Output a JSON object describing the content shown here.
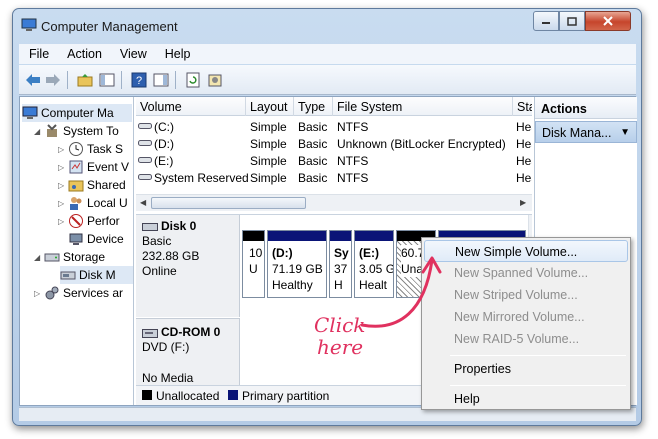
{
  "window": {
    "title": "Computer Management"
  },
  "menu": [
    "File",
    "Action",
    "View",
    "Help"
  ],
  "tree": {
    "root": "Computer Ma",
    "system_tools": "System To",
    "task_scheduler": "Task S",
    "event_viewer": "Event V",
    "shared_folders": "Shared",
    "local_users": "Local U",
    "performance": "Perfor",
    "device_manager": "Device",
    "storage": "Storage",
    "disk_management": "Disk M",
    "services": "Services ar"
  },
  "volume_list": {
    "headers": [
      "Volume",
      "Layout",
      "Type",
      "File System",
      "Stat"
    ],
    "rows": [
      {
        "volume": "(C:)",
        "layout": "Simple",
        "type": "Basic",
        "fs": "NTFS",
        "status": "Hea"
      },
      {
        "volume": "(D:)",
        "layout": "Simple",
        "type": "Basic",
        "fs": "Unknown (BitLocker Encrypted)",
        "status": "Hea"
      },
      {
        "volume": "(E:)",
        "layout": "Simple",
        "type": "Basic",
        "fs": "NTFS",
        "status": "Hea"
      },
      {
        "volume": "System Reserved",
        "layout": "Simple",
        "type": "Basic",
        "fs": "NTFS",
        "status": "Hea"
      }
    ]
  },
  "disk0": {
    "name": "Disk 0",
    "type": "Basic",
    "size": "232.88 GB",
    "status": "Online",
    "partitions": [
      {
        "line1": "10",
        "line2": "U"
      },
      {
        "line1": "(D:)",
        "line2": "71.19 GB",
        "line3": "Healthy"
      },
      {
        "line1": "Sy",
        "line2": "37",
        "line3": "H"
      },
      {
        "line1": "(E:)",
        "line2": "3.05 G",
        "line3": "Healt"
      },
      {
        "line1": "60.79",
        "line2": "Unall"
      }
    ]
  },
  "cdrom": {
    "name": "CD-ROM 0",
    "drive": "DVD (F:)",
    "media": "No Media"
  },
  "legend": {
    "unallocated": "Unallocated",
    "primary": "Primary partition"
  },
  "actions": {
    "header": "Actions",
    "sub": "Disk Mana..."
  },
  "context_menu": {
    "new_simple": "New Simple Volume...",
    "new_spanned": "New Spanned Volume...",
    "new_striped": "New Striped Volume...",
    "new_mirrored": "New Mirrored Volume...",
    "new_raid5": "New RAID-5 Volume...",
    "properties": "Properties",
    "help": "Help"
  },
  "annotation": {
    "line1": "Click",
    "line2": "here"
  },
  "colors": {
    "primary_partition": "#0a1477",
    "unallocated": "#000000",
    "annotation": "#e0315f"
  }
}
